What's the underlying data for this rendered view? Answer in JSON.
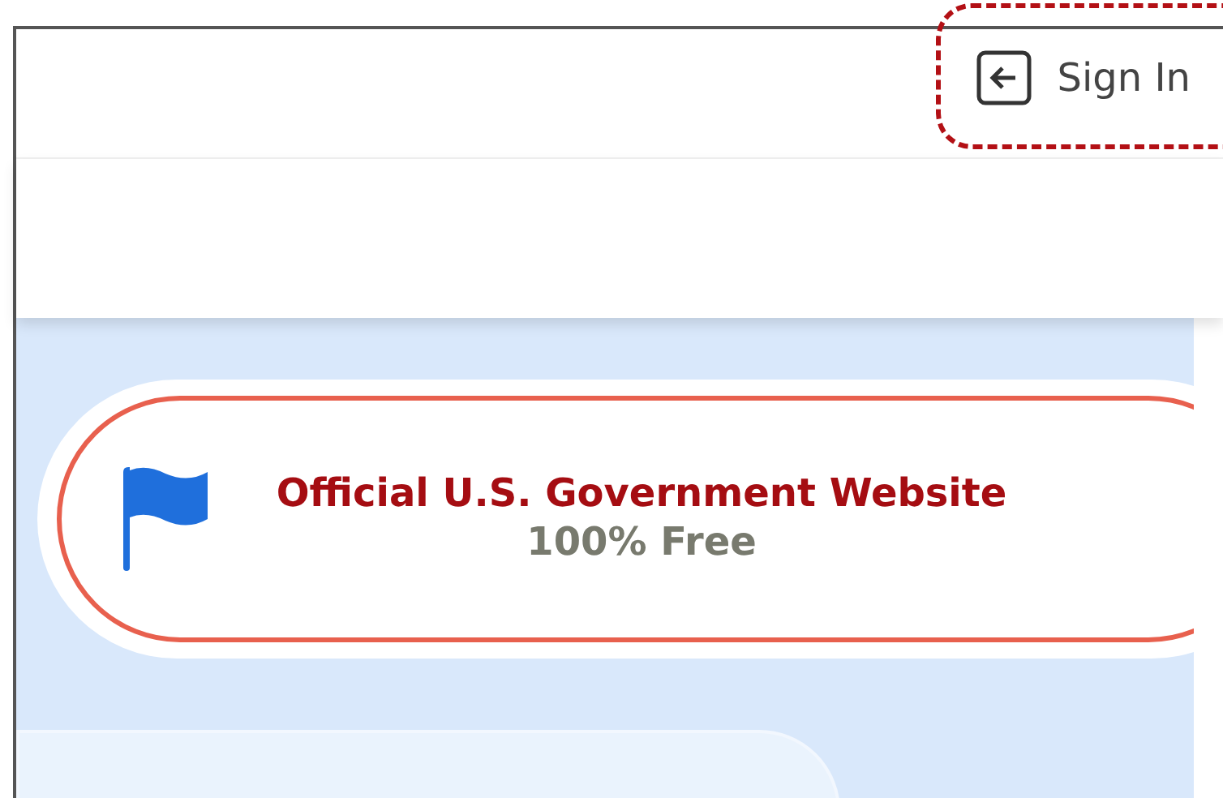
{
  "header": {
    "sign_in": {
      "label": "Sign In",
      "highlighted": true
    }
  },
  "banner": {
    "title": "Official U.S. Government Website",
    "subtitle": "100% Free"
  }
}
